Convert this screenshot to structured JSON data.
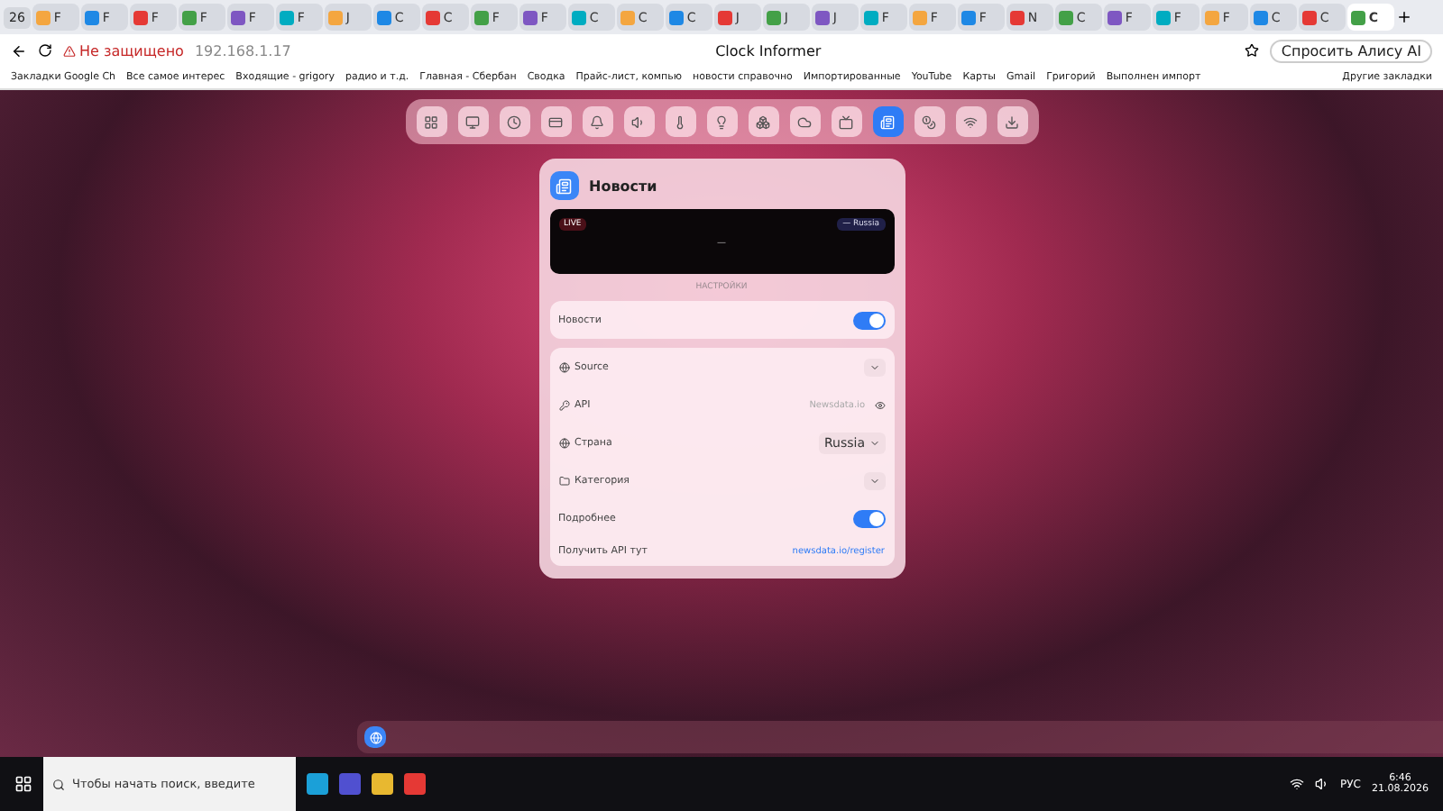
{
  "browser": {
    "tab_count": "26",
    "tabs": [
      {
        "label": "F",
        "selected": false
      },
      {
        "label": "F",
        "selected": false
      },
      {
        "label": "F",
        "selected": false
      },
      {
        "label": "F",
        "selected": false
      },
      {
        "label": "F",
        "selected": false
      },
      {
        "label": "F",
        "selected": false
      },
      {
        "label": "J",
        "selected": false
      },
      {
        "label": "C",
        "selected": false
      },
      {
        "label": "C",
        "selected": false
      },
      {
        "label": "F",
        "selected": false
      },
      {
        "label": "F",
        "selected": false
      },
      {
        "label": "C",
        "selected": false
      },
      {
        "label": "C",
        "selected": false
      },
      {
        "label": "C",
        "selected": false
      },
      {
        "label": "J",
        "selected": false
      },
      {
        "label": "J",
        "selected": false
      },
      {
        "label": "J",
        "selected": false
      },
      {
        "label": "F",
        "selected": false
      },
      {
        "label": "F",
        "selected": false
      },
      {
        "label": "F",
        "selected": false
      },
      {
        "label": "N",
        "selected": false
      },
      {
        "label": "C",
        "selected": false
      },
      {
        "label": "F",
        "selected": false
      },
      {
        "label": "F",
        "selected": false
      },
      {
        "label": "F",
        "selected": false
      },
      {
        "label": "C",
        "selected": false
      },
      {
        "label": "C",
        "selected": false
      },
      {
        "label": "C",
        "selected": true
      }
    ],
    "security": "Не защищено",
    "address": "192.168.1.17",
    "page_title": "Clock Informer",
    "assistant": "Спросить Алису AI",
    "bookmarks": [
      "Закладки Google Ch",
      "Все самое интерес",
      "Входящие - grigory",
      "радио и т.д.",
      "Главная - Сбербан",
      "Сводка",
      "Прайс-лист, компью",
      "новости справочно",
      "Импортированные",
      "YouTube",
      "Карты",
      "Gmail",
      "Григорий",
      "Выполнен импорт"
    ],
    "other_bookmarks": "Другие закладки"
  },
  "toolbar": [
    {
      "selected": false
    },
    {
      "selected": false
    },
    {
      "selected": false
    },
    {
      "selected": false
    },
    {
      "selected": false
    },
    {
      "selected": false
    },
    {
      "selected": false
    },
    {
      "selected": false
    },
    {
      "selected": false
    },
    {
      "selected": false
    },
    {
      "selected": false
    },
    {
      "selected": true
    },
    {
      "selected": false
    },
    {
      "selected": false
    },
    {
      "selected": false
    }
  ],
  "panel": {
    "title": "Новости",
    "preview": {
      "badge": "LIVE",
      "country": "— Russia",
      "headline": "—"
    },
    "section": "НАСТРОЙКИ",
    "main_toggle": {
      "label": "Новости",
      "on": true
    },
    "settings": [
      {
        "kind": "select",
        "label": "Source"
      },
      {
        "kind": "secret",
        "label": "API",
        "placeholder": "Newsdata.io"
      },
      {
        "kind": "select",
        "label": "Страна",
        "value": "Russia"
      },
      {
        "kind": "select",
        "label": "Категория"
      },
      {
        "kind": "toggle",
        "label": "Подробнее",
        "on": true
      },
      {
        "kind": "link",
        "label": "Получить API тут",
        "link": "newsdata.io/register"
      }
    ]
  },
  "taskbar": {
    "search_placeholder": "Чтобы начать поиск, введите",
    "language": "РУС",
    "time": "6:46",
    "date": "21.08.2026"
  }
}
